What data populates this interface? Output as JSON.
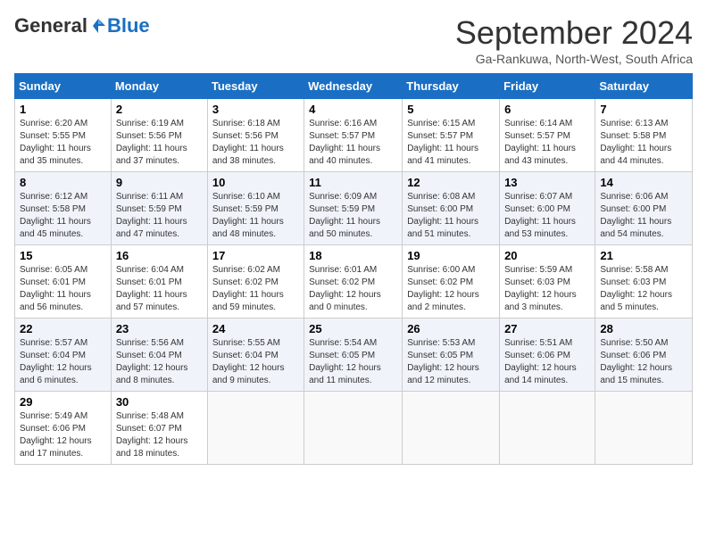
{
  "header": {
    "logo_general": "General",
    "logo_blue": "Blue",
    "month_title": "September 2024",
    "subtitle": "Ga-Rankuwa, North-West, South Africa"
  },
  "weekdays": [
    "Sunday",
    "Monday",
    "Tuesday",
    "Wednesday",
    "Thursday",
    "Friday",
    "Saturday"
  ],
  "weeks": [
    [
      {
        "day": "1",
        "sunrise": "6:20 AM",
        "sunset": "5:55 PM",
        "daylight": "11 hours and 35 minutes."
      },
      {
        "day": "2",
        "sunrise": "6:19 AM",
        "sunset": "5:56 PM",
        "daylight": "11 hours and 37 minutes."
      },
      {
        "day": "3",
        "sunrise": "6:18 AM",
        "sunset": "5:56 PM",
        "daylight": "11 hours and 38 minutes."
      },
      {
        "day": "4",
        "sunrise": "6:16 AM",
        "sunset": "5:57 PM",
        "daylight": "11 hours and 40 minutes."
      },
      {
        "day": "5",
        "sunrise": "6:15 AM",
        "sunset": "5:57 PM",
        "daylight": "11 hours and 41 minutes."
      },
      {
        "day": "6",
        "sunrise": "6:14 AM",
        "sunset": "5:57 PM",
        "daylight": "11 hours and 43 minutes."
      },
      {
        "day": "7",
        "sunrise": "6:13 AM",
        "sunset": "5:58 PM",
        "daylight": "11 hours and 44 minutes."
      }
    ],
    [
      {
        "day": "8",
        "sunrise": "6:12 AM",
        "sunset": "5:58 PM",
        "daylight": "11 hours and 45 minutes."
      },
      {
        "day": "9",
        "sunrise": "6:11 AM",
        "sunset": "5:59 PM",
        "daylight": "11 hours and 47 minutes."
      },
      {
        "day": "10",
        "sunrise": "6:10 AM",
        "sunset": "5:59 PM",
        "daylight": "11 hours and 48 minutes."
      },
      {
        "day": "11",
        "sunrise": "6:09 AM",
        "sunset": "5:59 PM",
        "daylight": "11 hours and 50 minutes."
      },
      {
        "day": "12",
        "sunrise": "6:08 AM",
        "sunset": "6:00 PM",
        "daylight": "11 hours and 51 minutes."
      },
      {
        "day": "13",
        "sunrise": "6:07 AM",
        "sunset": "6:00 PM",
        "daylight": "11 hours and 53 minutes."
      },
      {
        "day": "14",
        "sunrise": "6:06 AM",
        "sunset": "6:00 PM",
        "daylight": "11 hours and 54 minutes."
      }
    ],
    [
      {
        "day": "15",
        "sunrise": "6:05 AM",
        "sunset": "6:01 PM",
        "daylight": "11 hours and 56 minutes."
      },
      {
        "day": "16",
        "sunrise": "6:04 AM",
        "sunset": "6:01 PM",
        "daylight": "11 hours and 57 minutes."
      },
      {
        "day": "17",
        "sunrise": "6:02 AM",
        "sunset": "6:02 PM",
        "daylight": "11 hours and 59 minutes."
      },
      {
        "day": "18",
        "sunrise": "6:01 AM",
        "sunset": "6:02 PM",
        "daylight": "12 hours and 0 minutes."
      },
      {
        "day": "19",
        "sunrise": "6:00 AM",
        "sunset": "6:02 PM",
        "daylight": "12 hours and 2 minutes."
      },
      {
        "day": "20",
        "sunrise": "5:59 AM",
        "sunset": "6:03 PM",
        "daylight": "12 hours and 3 minutes."
      },
      {
        "day": "21",
        "sunrise": "5:58 AM",
        "sunset": "6:03 PM",
        "daylight": "12 hours and 5 minutes."
      }
    ],
    [
      {
        "day": "22",
        "sunrise": "5:57 AM",
        "sunset": "6:04 PM",
        "daylight": "12 hours and 6 minutes."
      },
      {
        "day": "23",
        "sunrise": "5:56 AM",
        "sunset": "6:04 PM",
        "daylight": "12 hours and 8 minutes."
      },
      {
        "day": "24",
        "sunrise": "5:55 AM",
        "sunset": "6:04 PM",
        "daylight": "12 hours and 9 minutes."
      },
      {
        "day": "25",
        "sunrise": "5:54 AM",
        "sunset": "6:05 PM",
        "daylight": "12 hours and 11 minutes."
      },
      {
        "day": "26",
        "sunrise": "5:53 AM",
        "sunset": "6:05 PM",
        "daylight": "12 hours and 12 minutes."
      },
      {
        "day": "27",
        "sunrise": "5:51 AM",
        "sunset": "6:06 PM",
        "daylight": "12 hours and 14 minutes."
      },
      {
        "day": "28",
        "sunrise": "5:50 AM",
        "sunset": "6:06 PM",
        "daylight": "12 hours and 15 minutes."
      }
    ],
    [
      {
        "day": "29",
        "sunrise": "5:49 AM",
        "sunset": "6:06 PM",
        "daylight": "12 hours and 17 minutes."
      },
      {
        "day": "30",
        "sunrise": "5:48 AM",
        "sunset": "6:07 PM",
        "daylight": "12 hours and 18 minutes."
      },
      null,
      null,
      null,
      null,
      null
    ]
  ],
  "labels": {
    "sunrise": "Sunrise: ",
    "sunset": "Sunset: ",
    "daylight": "Daylight: "
  }
}
